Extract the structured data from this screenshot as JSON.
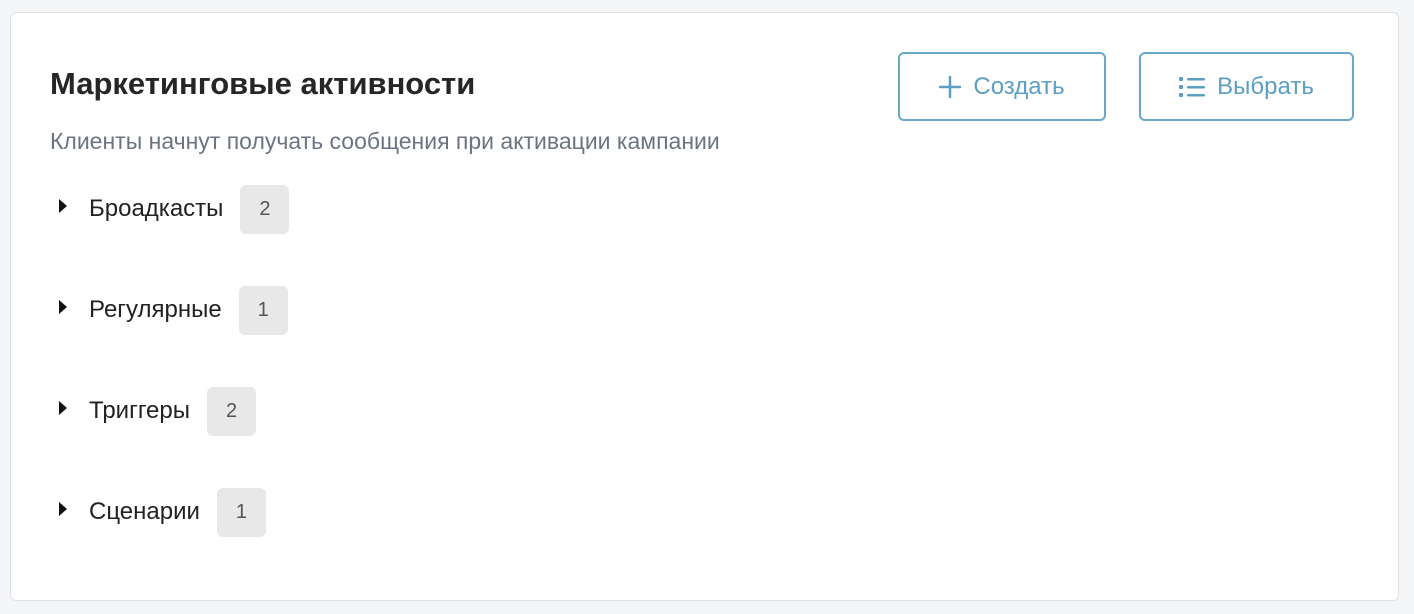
{
  "section": {
    "title": "Маркетинговые активности",
    "subtitle": "Клиенты начнут получать сообщения при активации кампании"
  },
  "actions": {
    "create_label": "Создать",
    "create_icon": "plus-icon",
    "select_label": "Выбрать",
    "select_icon": "list-icon",
    "accent_color": "#5c9fc3"
  },
  "groups": [
    {
      "label": "Броадкасты",
      "count": "2"
    },
    {
      "label": "Регулярные",
      "count": "1"
    },
    {
      "label": "Триггеры",
      "count": "2"
    },
    {
      "label": "Сценарии",
      "count": "1"
    }
  ]
}
